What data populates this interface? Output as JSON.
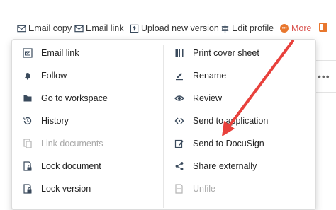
{
  "toolbar": {
    "email_copy": "Email copy",
    "email_link": "Email link",
    "upload_new_version": "Upload new version",
    "edit_profile": "Edit profile",
    "more": "More"
  },
  "menu": {
    "left": [
      {
        "label": "Email link",
        "icon": "email-link-icon"
      },
      {
        "label": "Follow",
        "icon": "bell-icon"
      },
      {
        "label": "Go to workspace",
        "icon": "folder-icon"
      },
      {
        "label": "History",
        "icon": "history-icon"
      },
      {
        "label": "Link documents",
        "icon": "link-documents-icon",
        "disabled": true
      },
      {
        "label": "Lock document",
        "icon": "lock-document-icon"
      },
      {
        "label": "Lock version",
        "icon": "lock-version-icon"
      }
    ],
    "right": [
      {
        "label": "Print cover sheet",
        "icon": "barcode-icon"
      },
      {
        "label": "Rename",
        "icon": "rename-pencil-icon"
      },
      {
        "label": "Review",
        "icon": "eye-icon"
      },
      {
        "label": "Send to application",
        "icon": "send-to-application-icon"
      },
      {
        "label": "Send to DocuSign",
        "icon": "docusign-edit-icon"
      },
      {
        "label": "Share externally",
        "icon": "share-icon"
      },
      {
        "label": "Unfile",
        "icon": "unfile-icon",
        "disabled": true
      }
    ]
  },
  "colors": {
    "accent": "#e8772e",
    "arrow": "#e8413c",
    "icon": "#3a4a5c",
    "disabled": "#a9a9a9"
  }
}
